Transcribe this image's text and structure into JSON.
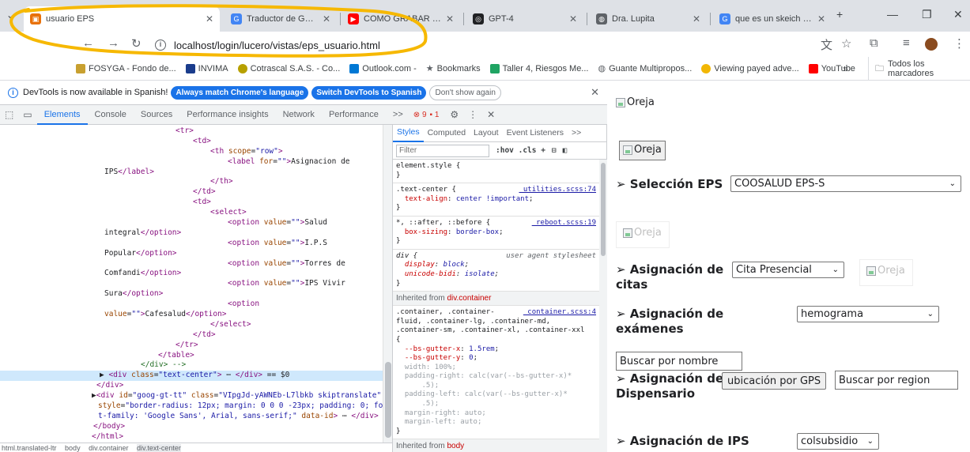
{
  "tabs": [
    {
      "label": "usuario EPS",
      "active": true,
      "color": "#e8710a"
    },
    {
      "label": "Traductor de Google",
      "active": false,
      "color": "#4285f4"
    },
    {
      "label": "COMO GRABAR PA",
      "active": false,
      "color": "#ff0000"
    },
    {
      "label": "GPT-4",
      "active": false,
      "color": "#202124"
    },
    {
      "label": "Dra. Lupita",
      "active": false,
      "color": "#5f6368"
    },
    {
      "label": "que es un skeich - Bu",
      "active": false,
      "color": "#4285f4"
    }
  ],
  "toolbar": {
    "url": "localhost/login/lucero/vistas/eps_usuario.html"
  },
  "bookmarks": [
    {
      "label": "FOSYGA - Fondo de...",
      "color": "#c8a030"
    },
    {
      "label": "INVIMA",
      "color": "#1a3c8c"
    },
    {
      "label": "Cotrascal S.A.S. - Co...",
      "color": "#b7a000"
    },
    {
      "label": "Outlook.com -",
      "color": "#0078d4"
    },
    {
      "label": "Bookmarks",
      "color": "#5f6368"
    },
    {
      "label": "Taller 4, Riesgos Me...",
      "color": "#1fa463"
    },
    {
      "label": "Guante Multipropos...",
      "color": "#5f6368"
    },
    {
      "label": "Viewing payed adve...",
      "color": "#f2b705"
    },
    {
      "label": "YouTube",
      "color": "#ff0000"
    }
  ],
  "bookmarks_more": "»",
  "bookmarks_all": "Todos los marcadores",
  "devtools": {
    "info_text": "DevTools is now available in Spanish!",
    "btn_match": "Always match Chrome's language",
    "btn_switch": "Switch DevTools to Spanish",
    "btn_dont": "Don't show again",
    "tabs": [
      "Elements",
      "Console",
      "Sources",
      "Performance insights",
      "Network",
      "Performance",
      ">>"
    ],
    "errors": "9",
    "warnings": "1",
    "breadcrumbs": [
      "html.translated-ltr",
      "body",
      "div.container",
      "div.text-center"
    ],
    "styles_tabs": [
      "Styles",
      "Computed",
      "Layout",
      "Event Listeners",
      ">>"
    ],
    "filter_placeholder": "Filter",
    "filter_tools": ":hov  .cls  +",
    "inherited_container": "Inherited from",
    "inherited_container_sel": "div.container",
    "inherited_body": "Inherited from",
    "inherited_body_sel": "body"
  },
  "page": {
    "img_alt": "Oreja",
    "section_eps": "➢ Selección EPS",
    "eps_value": "COOSALUD EPS-S",
    "section_citas": "➢ Asignación de citas",
    "citas_value": "Cita Presencial",
    "section_examenes": "➢ Asignación de exámenes",
    "examenes_value": "hemograma",
    "search_name": "Buscar por nombre",
    "section_dispensario": "➢ Asignación de Dispensario",
    "gps_button": "ubicación por GPS",
    "search_region": "Buscar por region",
    "section_ips": "➢ Asignación de IPS",
    "ips_value": "colsubsidio"
  }
}
